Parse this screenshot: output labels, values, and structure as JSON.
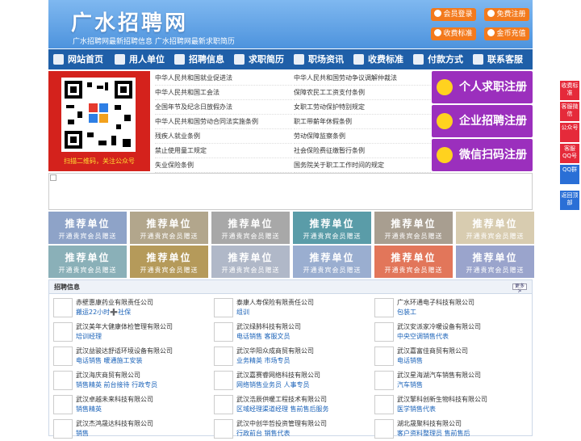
{
  "header": {
    "title": "广水招聘网",
    "slogan": "广水招聘网最新招聘信息  广水招聘网最新求职简历",
    "buttons": [
      "会员登录",
      "免费注册",
      "收费标准",
      "金币充值"
    ]
  },
  "nav": [
    "网站首页",
    "用人单位",
    "招聘信息",
    "求职简历",
    "职场资讯",
    "收费标准",
    "付款方式",
    "联系客服"
  ],
  "banner": {
    "caption": "扫描二维码，关注公众号"
  },
  "laws_left": [
    "中华人民共和国就业促进法",
    "中华人民共和国工会法",
    "全国年节及纪念日放假办法",
    "中华人民共和国劳动合同法实施条例",
    "残疾人就业条例",
    "禁止使用童工规定",
    "失业保险条例"
  ],
  "laws_right": [
    "中华人民共和国劳动争议调解仲裁法",
    "保障农民工工资支付条例",
    "女职工劳动保护特别规定",
    "职工带薪年休假条例",
    "劳动保障监察条例",
    "社会保险费征缴暂行条例",
    "国务院关于职工工作时间的规定"
  ],
  "register": [
    "个人求职注册",
    "企业招聘注册",
    "微信扫码注册"
  ],
  "tiles": {
    "title": "推荐单位",
    "sub": "开通贵宾会员赠送",
    "colors": [
      "#8ea3c8",
      "#b2a68c",
      "#a8a8a8",
      "#5a9ca8",
      "#a89e90",
      "#d8ccb0",
      "#8ab0b8",
      "#b59a5a",
      "#b0b8c8",
      "#9aaed0",
      "#e2765a",
      "#9aa4cc"
    ]
  },
  "jobs": {
    "head": "招聘信息",
    "more": "更多>",
    "list": [
      {
        "company": "赤壁惠康药业有限责任公司",
        "positions": "搬运22小时➕社保"
      },
      {
        "company": "泰康人寿保险有限责任公司",
        "positions": "组训"
      },
      {
        "company": "广水环通电子科技有限公司",
        "positions": "包装工"
      },
      {
        "company": "武汉美年大健康体检管理有限公司",
        "positions": "培训经理"
      },
      {
        "company": "武汉绿肺科技有限公司",
        "positions": "电话销售  客服文员"
      },
      {
        "company": "武汉安派家冷暖设备有限公司",
        "positions": "中央空调销售代表"
      },
      {
        "company": "武汉益骏达舒适环境设备有限公司",
        "positions": "电话销售  暖通施工安装"
      },
      {
        "company": "武汉华阳众成商贸有限公司",
        "positions": "业务精英  市场专员"
      },
      {
        "company": "武汉嘉富佳商贸有限公司",
        "positions": "电话销售"
      },
      {
        "company": "武汉海庆商贸有限公司",
        "positions": "销售精英  前台接待  行政专员"
      },
      {
        "company": "武汉嘉赛睿网络科技有限公司",
        "positions": "网络销售业务员  人事专员"
      },
      {
        "company": "武汉星海湖汽车销售有限公司",
        "positions": "汽车销售"
      },
      {
        "company": "武汉卓越未来科技有限公司",
        "positions": "销售精英"
      },
      {
        "company": "武汉浩辰供暖工程技术有限公司",
        "positions": "区域经理渠道经理  售前售后服务"
      },
      {
        "company": "武汉擎科创新生物科技有限公司",
        "positions": "医学销售代表"
      },
      {
        "company": "武汉杰鸿晟达科技有限公司",
        "positions": "销售"
      },
      {
        "company": "武汉中创华哲投资管理有限公司",
        "positions": "行政前台  销售代表"
      },
      {
        "company": "湖北晟聚科技有限公司",
        "positions": "客户资料整理员  售前售后"
      }
    ]
  },
  "side": [
    "收费标准",
    "客服微信",
    "公众号",
    "客服QQ号",
    "QQ群",
    "返回顶部"
  ]
}
